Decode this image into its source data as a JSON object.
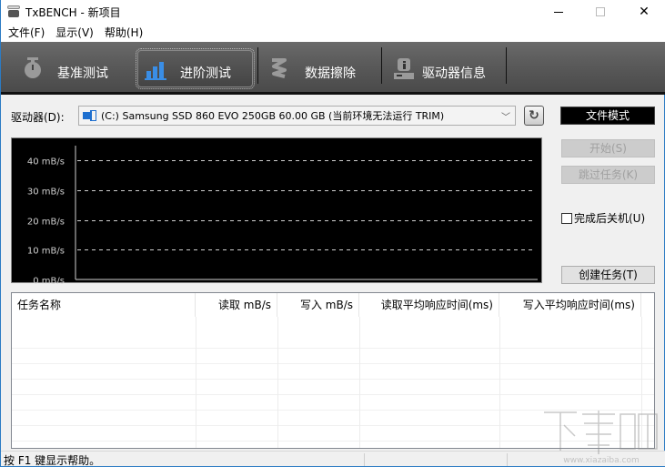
{
  "window": {
    "title": "TxBENCH - 新项目",
    "controls": {
      "minimize": "minimize",
      "maximize": "maximize",
      "close": "close"
    }
  },
  "menu": [
    {
      "label": "文件(F)"
    },
    {
      "label": "显示(V)"
    },
    {
      "label": "帮助(H)"
    }
  ],
  "tabs": [
    {
      "label": "基准测试",
      "icon": "stopwatch-icon",
      "active": false
    },
    {
      "label": "进阶测试",
      "icon": "bar-chart-icon",
      "active": true
    },
    {
      "label": "数据擦除",
      "icon": "eraser-icon",
      "active": false
    },
    {
      "label": "驱动器信息",
      "icon": "drive-info-icon",
      "active": false
    }
  ],
  "drive": {
    "label": "驱动器(D):",
    "selected": "(C:) Samsung SSD 860 EVO 250GB  60.00 GB (当前环境无法运行 TRIM)",
    "refresh_icon": "refresh-icon",
    "mode_button": "文件模式"
  },
  "colors": {
    "chart_bg": "#000000",
    "grid": "#cfcfcf",
    "tab_bar": "#5a5a5a",
    "active_icon": "#3a8ee6"
  },
  "chart_data": {
    "type": "line",
    "title": "",
    "xlabel": "",
    "ylabel": "",
    "y_ticks": [
      "0 mB/s",
      "10 mB/s",
      "20 mB/s",
      "30 mB/s",
      "40 mB/s"
    ],
    "y_values": [
      0,
      10,
      20,
      30,
      40
    ],
    "ylim": [
      0,
      45
    ],
    "grid": "dashed-horizontal",
    "series": []
  },
  "actions": {
    "start": "开始(S)",
    "skip": "跳过任务(K)",
    "shutdown_checkbox": "完成后关机(U)",
    "shutdown_checked": false,
    "create_task": "创建任务(T)"
  },
  "table": {
    "columns": [
      "任务名称",
      "读取 mB/s",
      "写入 mB/s",
      "读取平均响应时间(ms)",
      "写入平均响应时间(ms)"
    ],
    "rows": []
  },
  "status": {
    "text": "按 F1 键显示帮助。"
  },
  "watermark": {
    "text": "下载吧",
    "url_text": "www.xiazaiba.com"
  }
}
